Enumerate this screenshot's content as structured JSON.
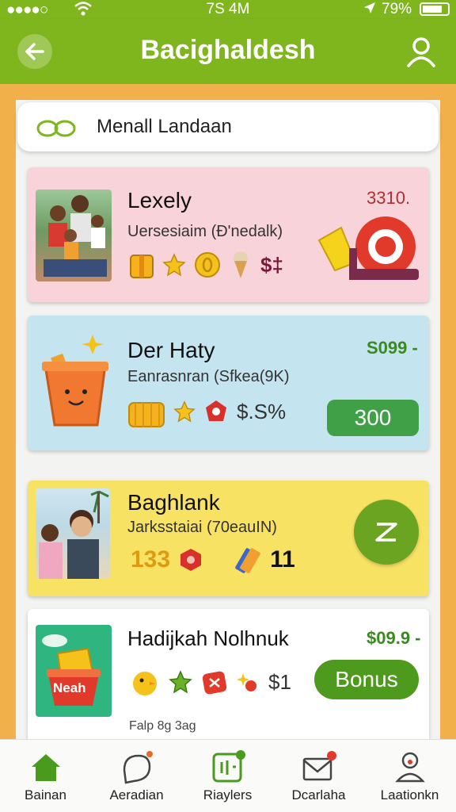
{
  "status": {
    "time": "7S 4M",
    "battery": "79%",
    "battery_level": 0.79,
    "signal": "●●●●○"
  },
  "header": {
    "title": "Bacighaldesh"
  },
  "search": {
    "text": "Menall Landaan"
  },
  "cards": [
    {
      "title": "Lexely",
      "subtitle": "Uersesiaim (Ð'nedalk)",
      "price": "3310.",
      "icon_text": "$‡",
      "bg": "#f8d4da",
      "icons": [
        "gift-box-icon",
        "star-icon",
        "coin-icon",
        "ice-cream-icon"
      ]
    },
    {
      "title": "Der Haty",
      "subtitle": "Eanrasnran (Sfkea(9K)",
      "price": "S099 -",
      "icon_text": "$.S%",
      "button": "300",
      "bg": "#c4e4ef",
      "icons": [
        "gift-box-icon",
        "star-icon",
        "badge-icon"
      ]
    },
    {
      "title": "Baghlank",
      "subtitle": "Jarksstaiai (70eauIN)",
      "num_a": "133",
      "num_b": "11",
      "bg": "#f8e264",
      "icons": [
        "candy-icon",
        "ticket-icon"
      ]
    },
    {
      "title": "Hadijkah Nolhnuk",
      "subtitle": "",
      "price": "$09.9 -",
      "icon_text": "$1",
      "button": "Bonus",
      "thumb_label": "Neah",
      "bg": "#ffffff",
      "icons": [
        "chick-icon",
        "star-icon",
        "badge-icon",
        "sparkle-icon"
      ]
    }
  ],
  "footnote": "Falp 8g 3ag",
  "tabs": [
    {
      "label": "Bainan",
      "icon": "home-icon",
      "active": true
    },
    {
      "label": "Aeradian",
      "icon": "compass-icon",
      "active": false
    },
    {
      "label": "Riaylers",
      "icon": "grid-icon",
      "active": false
    },
    {
      "label": "Dcarlaha",
      "icon": "mail-icon",
      "active": false
    },
    {
      "label": "Laationkn",
      "icon": "user-icon",
      "active": false
    }
  ],
  "colors": {
    "primary": "#7fb61e",
    "accent_green": "#3fa047",
    "side_orange": "#f2b04a"
  }
}
